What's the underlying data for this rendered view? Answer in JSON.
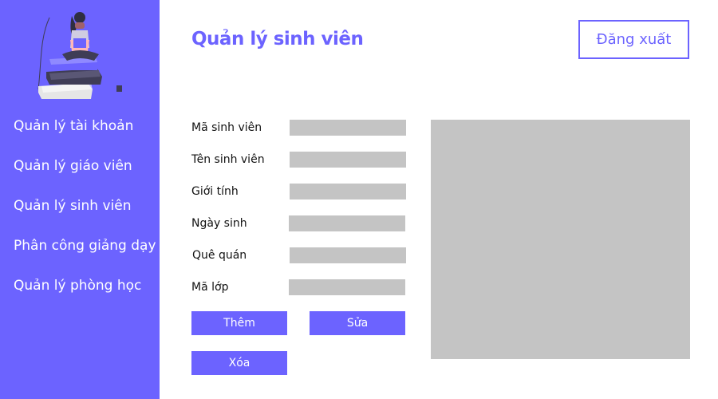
{
  "sidebar": {
    "illustration_icon": "person-reading-on-books-icon",
    "items": [
      {
        "label": "Quản lý tài khoản"
      },
      {
        "label": "Quản lý giáo viên"
      },
      {
        "label": "Quản lý sinh viên"
      },
      {
        "label": "Phân công giảng dạy"
      },
      {
        "label": "Quản lý phòng học"
      }
    ]
  },
  "header": {
    "title": "Quản lý sinh viên",
    "logout_label": "Đăng xuất"
  },
  "form": {
    "fields": [
      {
        "label": "Mã sinh viên",
        "value": ""
      },
      {
        "label": "Tên sinh viên",
        "value": ""
      },
      {
        "label": "Giới tính",
        "value": ""
      },
      {
        "label": "Ngày sinh",
        "value": ""
      },
      {
        "label": "Quê quán",
        "value": ""
      },
      {
        "label": "Mã lớp",
        "value": ""
      }
    ],
    "buttons": {
      "add": "Thêm",
      "edit": "Sửa",
      "delete": "Xóa"
    }
  },
  "photo": {
    "placeholder_icon": "image-placeholder"
  },
  "colors": {
    "primary": "#6c63ff",
    "placeholder_gray": "#c4c4c4",
    "white": "#ffffff"
  }
}
